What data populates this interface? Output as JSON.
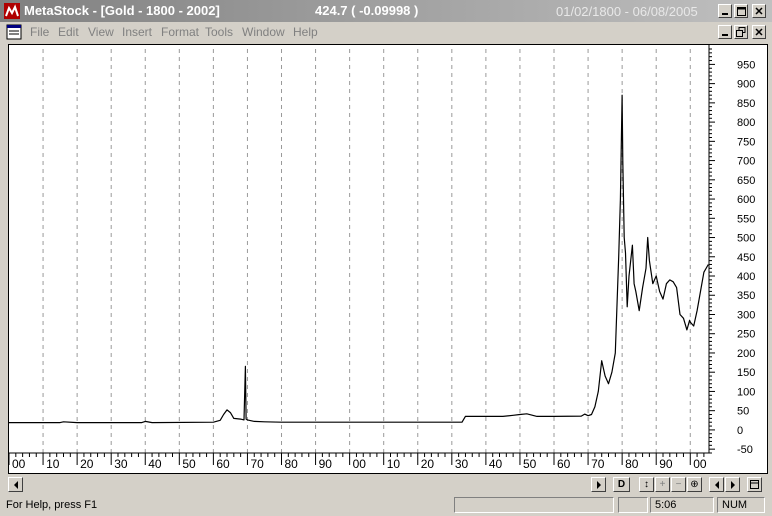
{
  "window": {
    "title": "MetaStock - [Gold - 1800 - 2002]",
    "price_readout": "424.7 ( -0.09998 )",
    "date_range": "01/02/1800 - 06/08/2005",
    "app_icon": "metastock-logo-icon"
  },
  "menu": {
    "doc_icon": "document-icon",
    "items": [
      "File",
      "Edit",
      "View",
      "Insert",
      "Format",
      "Tools",
      "Window",
      "Help"
    ]
  },
  "status": {
    "help_text": "For Help, press F1",
    "time": "5:06",
    "num": "NUM"
  },
  "scrollbar": {
    "buttons": [
      "D",
      "↕",
      "+",
      "−",
      "⊕"
    ]
  },
  "chart_data": {
    "type": "line",
    "title": "",
    "xlabel": "",
    "ylabel": "",
    "x_range": [
      1800,
      2005.5
    ],
    "ylim": [
      -60,
      990
    ],
    "y_ticks": [
      -50,
      0,
      50,
      100,
      150,
      200,
      250,
      300,
      350,
      400,
      450,
      500,
      550,
      600,
      650,
      700,
      750,
      800,
      850,
      900,
      950
    ],
    "x_ticks": [
      {
        "year": 1800,
        "label": "00"
      },
      {
        "year": 1810,
        "label": "10"
      },
      {
        "year": 1820,
        "label": "20"
      },
      {
        "year": 1830,
        "label": "30"
      },
      {
        "year": 1840,
        "label": "40"
      },
      {
        "year": 1850,
        "label": "50"
      },
      {
        "year": 1860,
        "label": "60"
      },
      {
        "year": 1870,
        "label": "70"
      },
      {
        "year": 1880,
        "label": "80"
      },
      {
        "year": 1890,
        "label": "90"
      },
      {
        "year": 1900,
        "label": "00"
      },
      {
        "year": 1910,
        "label": "10"
      },
      {
        "year": 1920,
        "label": "20"
      },
      {
        "year": 1930,
        "label": "30"
      },
      {
        "year": 1940,
        "label": "40"
      },
      {
        "year": 1950,
        "label": "50"
      },
      {
        "year": 1960,
        "label": "60"
      },
      {
        "year": 1970,
        "label": "70"
      },
      {
        "year": 1980,
        "label": "80"
      },
      {
        "year": 1990,
        "label": "90"
      },
      {
        "year": 2000,
        "label": "00"
      }
    ],
    "grid": "vertical dashed",
    "line_color": "#000000",
    "series": [
      {
        "x": [
          1800,
          1815,
          1816,
          1820,
          1839,
          1840,
          1842,
          1860,
          1862,
          1863,
          1864,
          1865,
          1866,
          1868,
          1869,
          1869.4,
          1869.6,
          1870,
          1872,
          1875,
          1880,
          1885,
          1900,
          1933,
          1934,
          1940,
          1945,
          1948,
          1950,
          1952,
          1955,
          1960,
          1968,
          1969,
          1970,
          1971,
          1972,
          1973,
          1974,
          1975,
          1976,
          1977,
          1978,
          1979,
          1979.5,
          1980,
          1980.2,
          1980.6,
          1981,
          1981.5,
          1982,
          1983,
          1983.5,
          1984,
          1985,
          1986,
          1987,
          1987.5,
          1988,
          1989,
          1990,
          1991,
          1992,
          1993,
          1994,
          1995,
          1996,
          1997,
          1998,
          1999,
          1999.8,
          2000,
          2001,
          2002,
          2003,
          2004,
          2005.3
        ],
        "y": [
          19,
          19,
          21,
          19,
          19,
          22,
          19,
          20,
          25,
          40,
          52,
          45,
          30,
          28,
          26,
          165,
          28,
          26,
          22,
          21,
          20,
          20,
          20,
          20,
          35,
          35,
          35,
          38,
          40,
          42,
          35,
          35,
          36,
          41,
          37,
          40,
          60,
          100,
          180,
          140,
          120,
          150,
          200,
          450,
          600,
          870,
          700,
          500,
          460,
          320,
          400,
          480,
          380,
          360,
          310,
          370,
          420,
          500,
          440,
          380,
          400,
          360,
          340,
          380,
          390,
          385,
          370,
          300,
          290,
          260,
          285,
          280,
          270,
          310,
          360,
          410,
          430
        ]
      }
    ]
  }
}
